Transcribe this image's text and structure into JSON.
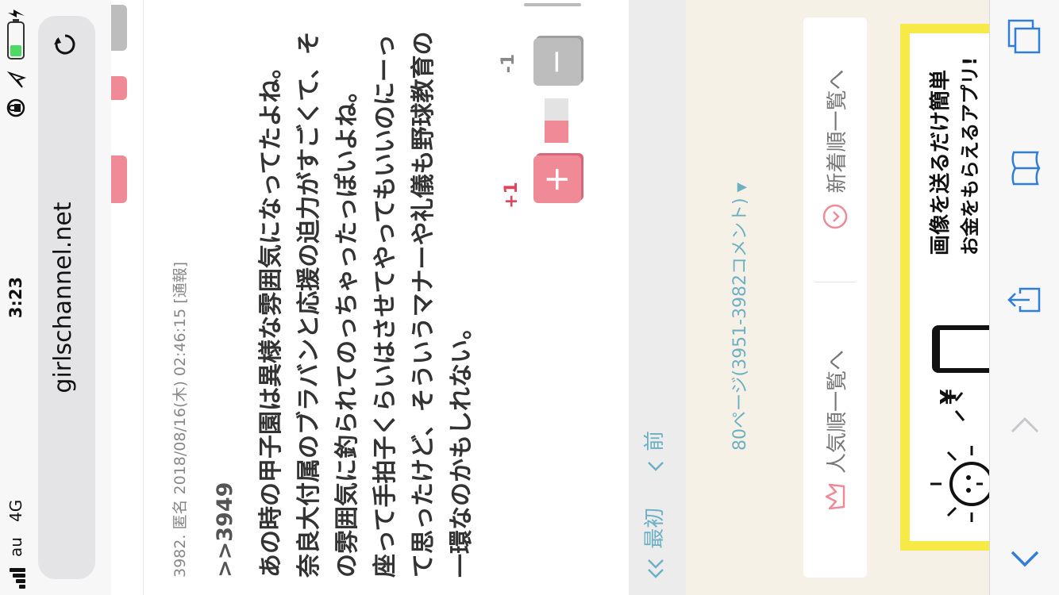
{
  "status_bar": {
    "carrier": "au",
    "network": "4G",
    "time": "3:23"
  },
  "browser": {
    "url": "girlschannel.net"
  },
  "comment": {
    "number": "3982.",
    "author": "匿名",
    "datetime": "2018/08/16(木) 02:46:15",
    "report_label": "[通報]",
    "reply_to": ">>3949",
    "body": "あの時の甲子園は異様な雰囲気になってたよね。\n奈良大付属のブラバンと応援の迫力がすごくて、そ\nの雰囲気に釣られてのっちゃったっぽいよね。\n座って手拍子くらいはさせてやってもいいのにーっ\nて思ったけど、そういうマナーや礼儀も野球教育の\n一環なのかもしれない。",
    "votes": {
      "plus_count": "+1",
      "minus_count": "-1",
      "plus_symbol": "+",
      "minus_symbol": "−",
      "plus_ratio": 0.5
    }
  },
  "pagination": {
    "first_label": "最初",
    "prev_label": "前",
    "page_info": "80ページ(3951-3982コメント)",
    "dropdown_glyph": "▼"
  },
  "list_buttons": {
    "popular": "人気順一覧へ",
    "newest": "新着順一覧へ"
  },
  "banner": {
    "line1": "画像を送るだけ簡単",
    "line2": "お金をもらえるアプリ!",
    "yen": "¥"
  },
  "colors": {
    "accent_pink": "#f08a96",
    "link_blue": "#6db0c4",
    "banner_yellow": "#f7e948",
    "toolbar_blue": "#2f7ed8"
  }
}
